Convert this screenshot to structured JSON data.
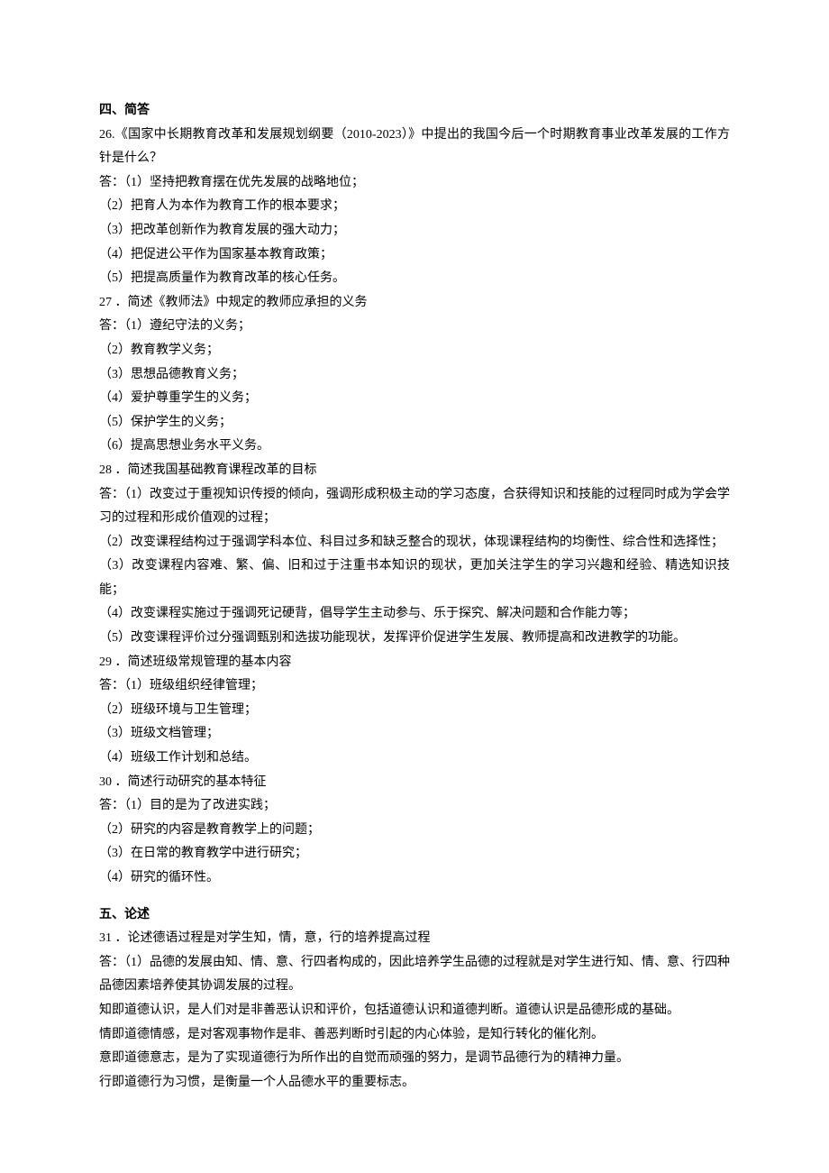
{
  "sections": [
    {
      "title": "四、简答",
      "items": [
        {
          "lines": [
            "26.《国家中长期教育改革和发展规划纲要（2010-2023）》中提出的我国今后一个时期教育事业改革发展的工作方针是什么？",
            "答：（1）坚持把教育摆在优先发展的战略地位；",
            "（2）把育人为本作为教育工作的根本要求；",
            "（3）把改革创新作为教育发展的强大动力；",
            "（4）把促进公平作为国家基本教育政策；",
            "（5）把提高质量作为教育改革的核心任务。"
          ]
        },
        {
          "lines": [
            "27 ．简述《教师法》中规定的教师应承担的义务",
            "答：（1）遵纪守法的义务；",
            "（2）教育教学义务；",
            "（3）思想品德教育义务；",
            "（4）爱护尊重学生的义务；",
            "（5）保护学生的义务；",
            "（6）提高思想业务水平义务。"
          ]
        },
        {
          "lines": [
            "28 ．简述我国基础教育课程改革的目标",
            "答：（1）改变过于重视知识传授的倾向，强调形成积极主动的学习态度，合获得知识和技能的过程同时成为学会学习的过程和形成价值观的过程；",
            "（2）改变课程结构过于强调学科本位、科目过多和缺乏整合的现状，体现课程结构的均衡性、综合性和选择性；",
            "（3）改变课程内容难、繁、偏、旧和过于注重书本知识的现状，更加关注学生的学习兴趣和经验、精选知识技能；",
            "（4）改变课程实施过于强调死记硬背，倡导学生主动参与、乐于探究、解决问题和合作能力等；",
            "（5）改变课程评价过分强调甄别和选拔功能现状，发挥评价促进学生发展、教师提高和改进教学的功能。"
          ]
        },
        {
          "lines": [
            "29 ．简述班级常规管理的基本内容",
            "答：（1）班级组织经律管理；",
            "（2）班级环境与卫生管理；",
            "（3）班级文档管理；",
            "（4）班级工作计划和总结。"
          ]
        },
        {
          "lines": [
            "30 ．简述行动研究的基本特征",
            "答：（1）目的是为了改进实践；",
            "（2）研究的内容是教育教学上的问题；",
            "（3）在日常的教育教学中进行研究；",
            "（4）研究的循环性。"
          ]
        }
      ]
    },
    {
      "title": "五、论述",
      "items": [
        {
          "lines": [
            "31 ．论述德语过程是对学生知，情，意，行的培养提高过程",
            "答：（1）品德的发展由知、情、意、行四者构成的，因此培养学生品德的过程就是对学生进行知、情、意、行四种品德因素培养使其协调发展的过程。",
            "知即道德认识，是人们对是非善恶认识和评价，包括道德认识和道德判断。道德认识是品德形成的基础。",
            "情即道德情感，是对客观事物作是非、善恶判断时引起的内心体验，是知行转化的催化剂。",
            "意即道德意志，是为了实现道德行为所作出的自觉而顽强的努力，是调节品德行为的精神力量。",
            "行即道德行为习惯，是衡量一个人品德水平的重要标志。"
          ]
        }
      ]
    }
  ]
}
